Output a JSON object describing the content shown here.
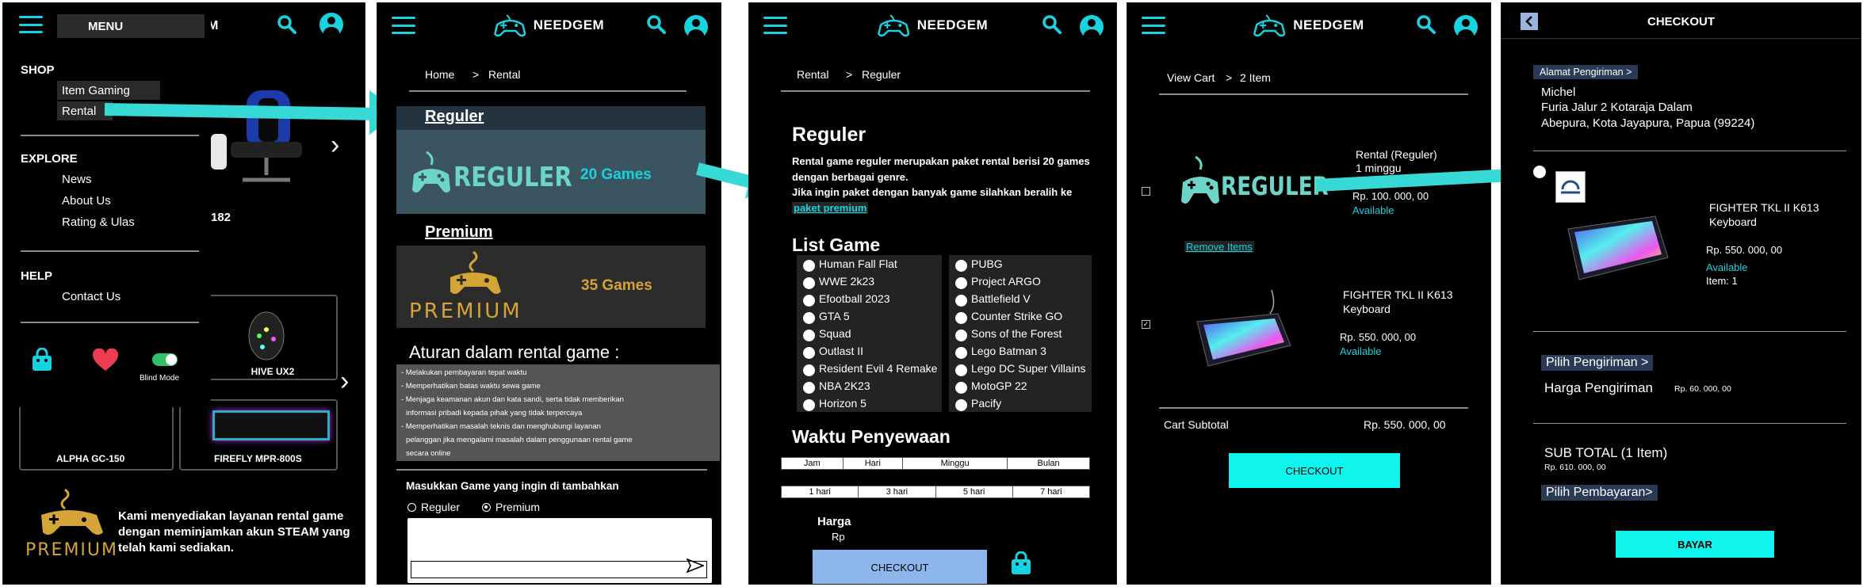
{
  "brand": "NEEDGEM",
  "colors": {
    "accent": "#17d3e0",
    "button": "#0ff5ee",
    "arrow": "#37d9d6"
  },
  "s1": {
    "menu_title": "MENU",
    "sections": [
      {
        "title": "SHOP",
        "items": [
          "Item Gaming",
          "Rental"
        ]
      },
      {
        "title": "EXPLORE",
        "items": [
          "News",
          "About Us",
          "Rating & Ulas"
        ]
      },
      {
        "title": "HELP",
        "items": [
          "Contact Us"
        ]
      }
    ],
    "blind_mode": "Blind Mode",
    "bg_m": "M",
    "bg_182": "182",
    "product1": "HIVE UX2",
    "product2": "FIREFLY MPR-800S",
    "product3": "ALPHA GC-150",
    "premium_word": "PREMIUM",
    "promo_text": "Kami menyediakan layanan rental game dengan meminjamkan akun STEAM yang telah kami sediakan."
  },
  "s2": {
    "crumb_home": "Home",
    "crumb_sep": ">",
    "crumb_rental": "Rental",
    "reguler_heading": "Reguler",
    "reguler_banner": "REGULER",
    "reguler_count": "20 Games",
    "premium_heading": "Premium",
    "premium_banner": "PREMIUM",
    "premium_count": "35 Games",
    "rules_title": "Aturan dalam rental game :",
    "rules": [
      "- Melakukan pembayaran tepat waktu",
      "- Memperhatikan batas waktu sewa game",
      "- Menjaga keamanan akun dan kata sandi, serta tidak memberikan",
      "  informasi pribadi kepada pihak yang tidak terpercaya",
      "- Memperhatikan masalah teknis dan menghubungi layanan",
      "  pelanggan jika mengalami masalah dalam penggunaan rental game",
      "  secara online"
    ],
    "add_label": "Masukkan Game yang ingin di tambahkan",
    "opt_reguler": "Reguler",
    "opt_premium": "Premium"
  },
  "s3": {
    "crumb_rental": "Rental",
    "crumb_sep": ">",
    "crumb_reguler": "Reguler",
    "title": "Reguler",
    "desc1": "Rental game reguler merupakan paket rental berisi 20 games dengan berbagai genre.",
    "desc2": "Jika ingin paket dengan banyak game silahkan beralih ke",
    "desc_link": "paket premium",
    "list_title": "List Game",
    "games_left": [
      "Human Fall Flat",
      "WWE 2k23",
      "Efootball 2023",
      "GTA 5",
      "Squad",
      "Outlast II",
      "Resident Evil 4 Remake",
      "NBA 2K23",
      "Horizon 5"
    ],
    "games_right": [
      "PUBG",
      "Project ARGO",
      "Battlefield V",
      "Counter Strike GO",
      "Sons of the Forest",
      "Lego Batman 3",
      "Lego DC Super Villains",
      "MotoGP 22",
      "Pacify"
    ],
    "waktu_title": "Waktu Penyewaan",
    "units": [
      "Jam",
      "Hari",
      "Minggu",
      "Bulan"
    ],
    "durations": [
      "1 hari",
      "3 hari",
      "5 hari",
      "7 hari"
    ],
    "harga": "Harga",
    "rp": "Rp",
    "checkout": "CHECKOUT"
  },
  "s4": {
    "crumb_view": "View Cart",
    "crumb_sep": ">",
    "crumb_items": "2 Item",
    "item1_banner": "REGULER",
    "item1_name": "Rental (Reguler)",
    "item1_sub": "1 minggu",
    "item1_price": "Rp. 100. 000, 00",
    "item1_status": "Available",
    "remove": "Remove Items",
    "item2_name": "FIGHTER TKL II K613",
    "item2_sub": "Keyboard",
    "item2_price": "Rp. 550. 000, 00",
    "item2_status": "Available",
    "subtotal_label": "Cart Subtotal",
    "subtotal_value": "Rp. 550. 000, 00",
    "checkout": "CHECKOUT"
  },
  "s5": {
    "title": "CHECKOUT",
    "alamat_btn": "Alamat Pengiriman >",
    "addr_name": "Michel",
    "addr_line1": "Furia Jalur 2 Kotaraja Dalam",
    "addr_line2": "Abepura, Kota Jayapura, Papua (99224)",
    "item_name": "FIGHTER TKL II K613",
    "item_sub": "Keyboard",
    "item_price": "Rp. 550. 000, 00",
    "item_status": "Available",
    "item_qty": "Item: 1",
    "pilih_pengiriman": "Pilih Pengiriman >",
    "harga_pengiriman": "Harga Pengiriman",
    "harga_pengiriman_val": "Rp. 60. 000, 00",
    "subtotal": "SUB TOTAL (1 Item)",
    "subtotal_val": "Rp. 610. 000, 00",
    "pilih_pembayaran": "Pilih Pembayaran>",
    "bayar": "BAYAR"
  }
}
